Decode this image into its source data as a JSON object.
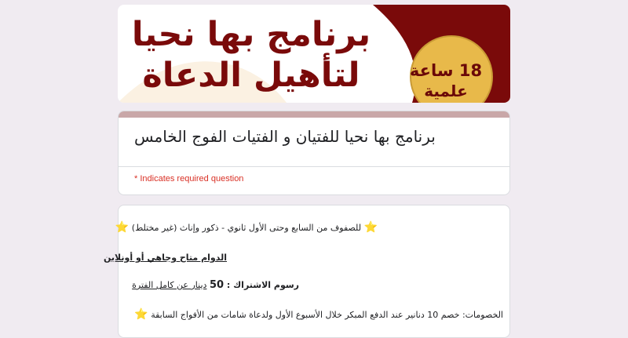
{
  "banner": {
    "title_line1": "برنامج بها نحيا",
    "title_line2": "لتأهيل الدعاة",
    "badge_line1": "18 ساعة",
    "badge_line2": "علمية"
  },
  "form": {
    "title": "برنامج بها نحيا للفتيان و الفتيات الفوج الخامس",
    "required_note": "* Indicates required question"
  },
  "description": {
    "line1_star": "⭐",
    "line1_text": "للصفوف من السابع وحتى الأول ثانوي - ذكور وإناث (غير مختلط)",
    "line1_star_end": "⭐",
    "line2_text": "الدوام متاح وجاهي أو أونلاين",
    "line3_label": "رسوم الاشتراك : ",
    "line3_value": "50",
    "line3_suffix": "دينار عن كامل الفترة",
    "line4_text": "الخصومات: خصم 10 دنانير عند الدفع المبكر خلال الأسبوع الأول ولدعاة شامات من الأفواج السابقة",
    "line4_star": "⭐"
  },
  "colors": {
    "brand_dark_red": "#7a0a0a",
    "accent_gold": "#e8b94a",
    "required_red": "#d93025"
  }
}
